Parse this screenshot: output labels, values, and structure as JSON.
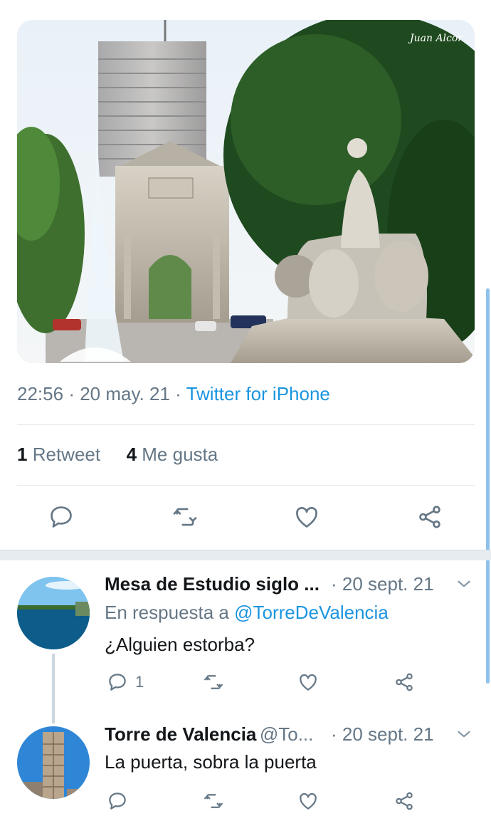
{
  "tweet": {
    "photo_watermark": "Juan Alcor",
    "time": "22:56",
    "date": "20 may. 21",
    "source": "Twitter for iPhone",
    "retweet_count": "1",
    "retweet_label": "Retweet",
    "like_count": "4",
    "like_label": "Me gusta",
    "actions": [
      "reply-icon",
      "retweet-icon",
      "like-icon",
      "share-icon"
    ]
  },
  "replies": [
    {
      "name": "Mesa de Estudio siglo ...",
      "handle": "",
      "date": "· 20 sept. 21",
      "reply_prefix": "En respuesta a",
      "reply_handle": "@TorreDeValencia",
      "text": "¿Alguien estorba?",
      "reply_count": "1"
    },
    {
      "name": "Torre de Valencia",
      "handle": "@To...",
      "date": "· 20 sept. 21",
      "text": "La puerta, sobra la puerta"
    }
  ],
  "colors": {
    "accent": "#1b95e0",
    "secondary_text": "#657786",
    "icon": "#657786"
  }
}
